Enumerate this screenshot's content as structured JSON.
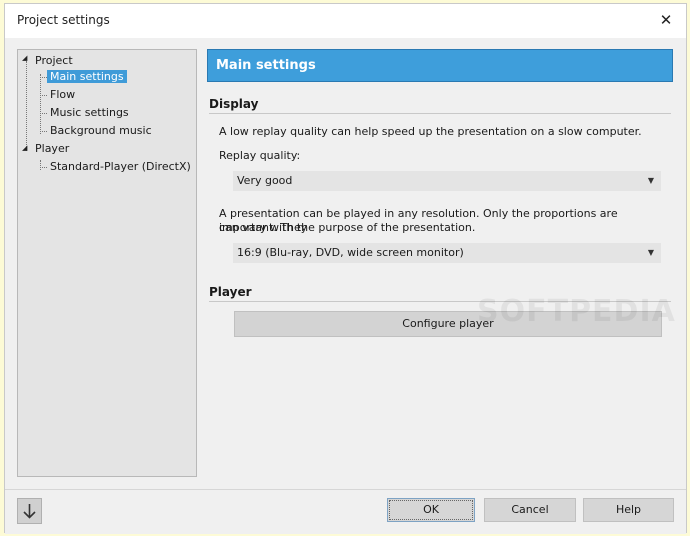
{
  "window": {
    "title": "Project settings"
  },
  "tree": {
    "items": [
      {
        "label": "Project"
      },
      {
        "label": "Main settings",
        "selected": true
      },
      {
        "label": "Flow"
      },
      {
        "label": "Music settings"
      },
      {
        "label": "Background music"
      },
      {
        "label": "Player"
      },
      {
        "label": "Standard-Player (DirectX)"
      }
    ]
  },
  "main": {
    "header": "Main settings",
    "display": {
      "title": "Display",
      "quality_desc": "A low replay quality can help speed up the presentation on a slow computer.",
      "quality_label": "Replay quality:",
      "quality_value": "Very good",
      "resolution_desc_1": "A presentation can be played in any resolution. Only the proportions are important. They",
      "resolution_desc_2": "can vary with the purpose of the presentation.",
      "resolution_value": "16:9 (Blu-ray, DVD, wide screen monitor)"
    },
    "player": {
      "title": "Player",
      "configure_label": "Configure player"
    }
  },
  "footer": {
    "ok_label": "OK",
    "cancel_label": "Cancel",
    "help_label": "Help"
  },
  "icons": {
    "close": "close-icon",
    "down_arrow": "arrow-down-icon",
    "expand": "expanded-triangle-icon",
    "dropdown": "chevron-down-icon"
  },
  "colors": {
    "accent": "#3e9edb",
    "selection": "#3f9bd8"
  },
  "watermark": "SOFTPEDIA"
}
